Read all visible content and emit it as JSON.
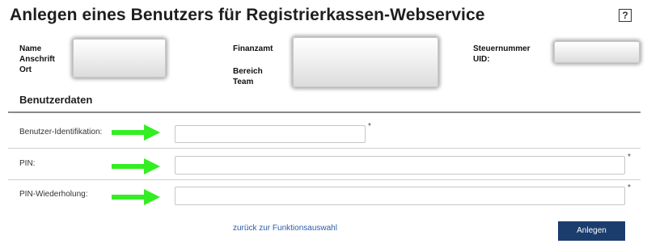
{
  "header": {
    "title": "Anlegen eines Benutzers für Registrierkassen-Webservice",
    "help_label": "?"
  },
  "info": {
    "col1": [
      "Name",
      "Anschrift",
      "Ort"
    ],
    "col2": [
      "Finanzamt",
      "Bereich",
      "Team"
    ],
    "col3": [
      "Steuernummer",
      "UID:"
    ]
  },
  "section": {
    "title": "Benutzerdaten"
  },
  "fields": {
    "user_id_label": "Benutzer-Identifikation:",
    "pin_label": "PIN:",
    "pin_repeat_label": "PIN-Wiederholung:",
    "required_marker": "*"
  },
  "footer": {
    "back_link": "zurück zur Funktionsauswahl",
    "submit_label": "Anlegen"
  },
  "colors": {
    "arrow": "#33ee22",
    "button": "#1a3d6d",
    "link": "#2a5da8"
  }
}
